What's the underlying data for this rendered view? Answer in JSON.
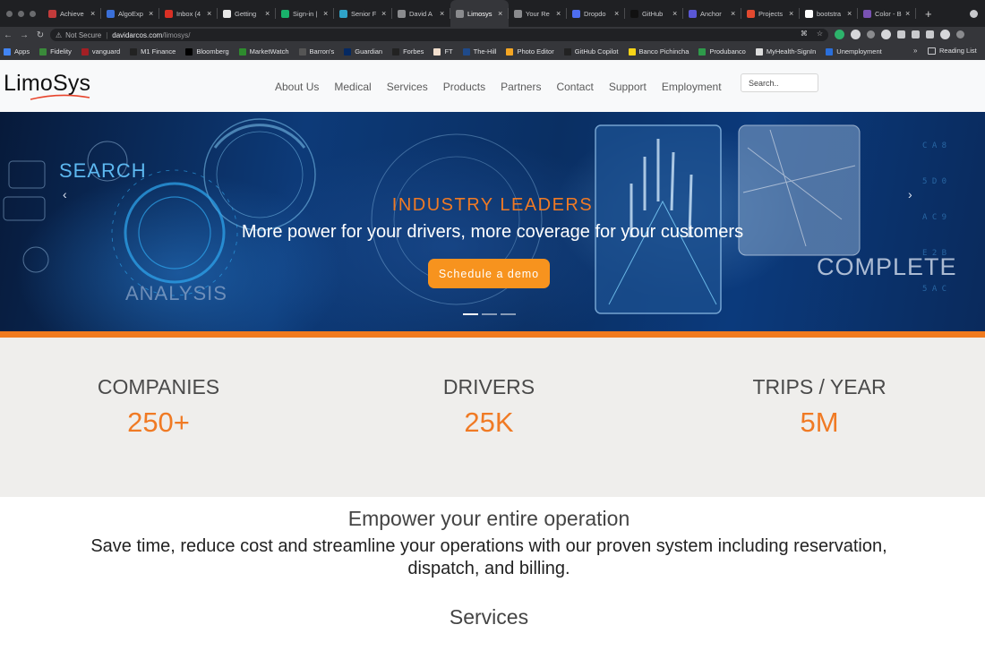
{
  "browser": {
    "tabs": [
      {
        "label": "Achieve",
        "icon": "achieve-favicon",
        "color": "#c23b3b"
      },
      {
        "label": "AlgoExp",
        "icon": "algoexpert-favicon",
        "color": "#3a6fd8"
      },
      {
        "label": "Inbox (4",
        "icon": "gmail-favicon",
        "color": "#d93025"
      },
      {
        "label": "Getting",
        "icon": "getting-favicon",
        "color": "#e8e8e8"
      },
      {
        "label": "Sign-in |",
        "icon": "signin-favicon",
        "color": "#19b26b"
      },
      {
        "label": "Senior F",
        "icon": "senior-favicon",
        "color": "#2fa3c8"
      },
      {
        "label": "David A",
        "icon": "globe-favicon",
        "color": "#8a8b8e"
      },
      {
        "label": "Limosys",
        "icon": "globe-favicon",
        "color": "#8a8b8e",
        "active": true
      },
      {
        "label": "Your Re",
        "icon": "globe-favicon",
        "color": "#8a8b8e"
      },
      {
        "label": "Dropdo",
        "icon": "dropdown-favicon",
        "color": "#4d6df0"
      },
      {
        "label": "GitHub",
        "icon": "github-favicon",
        "color": "#111111"
      },
      {
        "label": "Anchor",
        "icon": "anchor-favicon",
        "color": "#5a57d6"
      },
      {
        "label": "Projects",
        "icon": "gitlab-favicon",
        "color": "#e2492f"
      },
      {
        "label": "bootstra",
        "icon": "google-favicon",
        "color": "#ffffff"
      },
      {
        "label": "Color - B",
        "icon": "bootstrap-favicon",
        "color": "#7952b3"
      }
    ],
    "tab_close_glyph": "×",
    "new_tab_glyph": "+",
    "security_label": "Not Secure",
    "url_host": "davidarcos.com",
    "url_path": "/limosys/",
    "bookmarks": [
      {
        "label": "Apps",
        "color": "#4285f4"
      },
      {
        "label": "Fidelity",
        "color": "#3a8a3a"
      },
      {
        "label": "vanguard",
        "color": "#a31f24"
      },
      {
        "label": "M1 Finance",
        "color": "#222222"
      },
      {
        "label": "Bloomberg",
        "color": "#000000"
      },
      {
        "label": "MarketWatch",
        "color": "#2e8b2e"
      },
      {
        "label": "Barron's",
        "color": "#555555"
      },
      {
        "label": "Guardian",
        "color": "#052962"
      },
      {
        "label": "Forbes",
        "color": "#222222"
      },
      {
        "label": "FT",
        "color": "#f2dfce"
      },
      {
        "label": "The-Hill",
        "color": "#1f4a8a"
      },
      {
        "label": "Photo Editor",
        "color": "#f5a623"
      },
      {
        "label": "GitHub Copilot",
        "color": "#222222"
      },
      {
        "label": "Banco Pichincha",
        "color": "#f7d417"
      },
      {
        "label": "Produbanco",
        "color": "#2e9a4a"
      },
      {
        "label": "MyHealth-SignIn",
        "color": "#dddddd"
      },
      {
        "label": "Unemployment",
        "color": "#2a6fdb"
      }
    ],
    "bookmarks_more": "»",
    "reading_list": "Reading List"
  },
  "site": {
    "logo": "LimoSys",
    "nav": [
      "About Us",
      "Medical",
      "Services",
      "Products",
      "Partners",
      "Contact",
      "Support",
      "Employment"
    ],
    "search_placeholder": "Search..",
    "hero": {
      "kicker": "INDUSTRY LEADERS",
      "title": "More power for your drivers, more coverage for your customers",
      "cta": "Schedule a demo",
      "words": {
        "search": "SEARCH",
        "analysis": "ANALYSIS",
        "complete": "COMPLETE"
      },
      "slides": 3,
      "active_slide": 1,
      "prev_glyph": "‹",
      "next_glyph": "›"
    },
    "stats": [
      {
        "label": "COMPANIES",
        "value": "250+"
      },
      {
        "label": "DRIVERS",
        "value": "25K"
      },
      {
        "label": "TRIPS / YEAR",
        "value": "5M"
      }
    ],
    "intro": {
      "heading": "Empower your entire operation",
      "text": "Save time, reduce cost and streamline your operations with our proven system including reservation, dispatch, and billing."
    },
    "services_heading": "Services"
  },
  "colors": {
    "accent": "#f07a24",
    "cta": "#f7931e",
    "stats_bg": "#efeeec"
  }
}
